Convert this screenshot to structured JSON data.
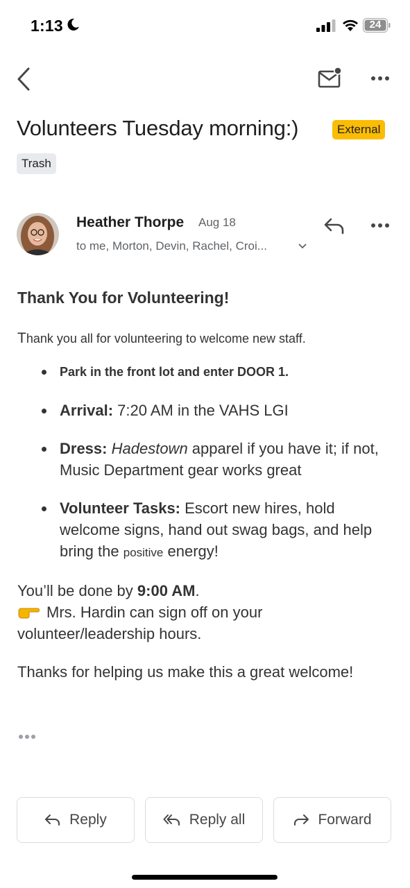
{
  "status_bar": {
    "time": "1:13",
    "battery": "24"
  },
  "email": {
    "subject": "Volunteers Tuesday morning:)",
    "external_badge": "External",
    "label_chip": "Trash",
    "sender": "Heather Thorpe",
    "date": "Aug 18",
    "recipients": "to me, Morton, Devin, Rachel, Croi..."
  },
  "body": {
    "heading": "Thank You for Volunteering!",
    "intro_first": "T",
    "intro_rest": "hank you all for volunteering to welcome new staff.",
    "bullet_1": "Park in the front lot and enter DOOR 1.",
    "bullet_2_label": "Arrival:",
    "bullet_2_text": " 7:20 AM in the VAHS LGI",
    "bullet_3_label": "Dress:",
    "bullet_3_italic": "Hadestown",
    "bullet_3_text": " apparel if you have it; if not, Music Department gear works great",
    "bullet_4_label": "Volunteer Tasks:",
    "bullet_4_text": " Escort new hires, hold welcome signs, hand out swag bags, and help bring the ",
    "bullet_4_small": "positive",
    "bullet_4_end": " energy!",
    "done_prefix": "You’ll be done by ",
    "done_time": "9:00 AM",
    "done_suffix": ".",
    "signoff_text": "Mrs. Hardin can sign off on your volunteer/leadership hours.",
    "closing": "Thanks for helping us make this a great welcome!"
  },
  "actions": {
    "reply": "Reply",
    "reply_all": "Reply all",
    "forward": "Forward"
  }
}
